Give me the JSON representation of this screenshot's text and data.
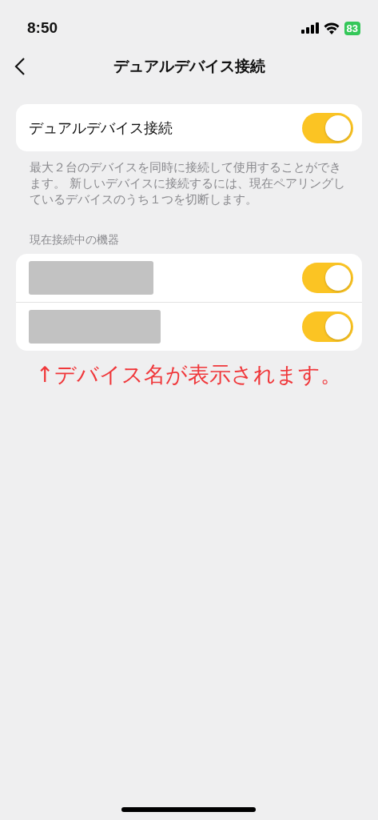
{
  "status_bar": {
    "time": "8:50",
    "battery": "83"
  },
  "nav": {
    "title": "デュアルデバイス接続"
  },
  "dual_toggle": {
    "label": "デュアルデバイス接続",
    "on": true
  },
  "description": "最大２台のデバイスを同時に接続して使用することができます。 新しいデバイスに接続するには、現在ペアリングしているデバイスのうち１つを切断します。",
  "section_header": "現在接続中の機器",
  "devices": [
    {
      "on": true
    },
    {
      "on": true
    }
  ],
  "annotation": "↑デバイス名が表示されます。"
}
